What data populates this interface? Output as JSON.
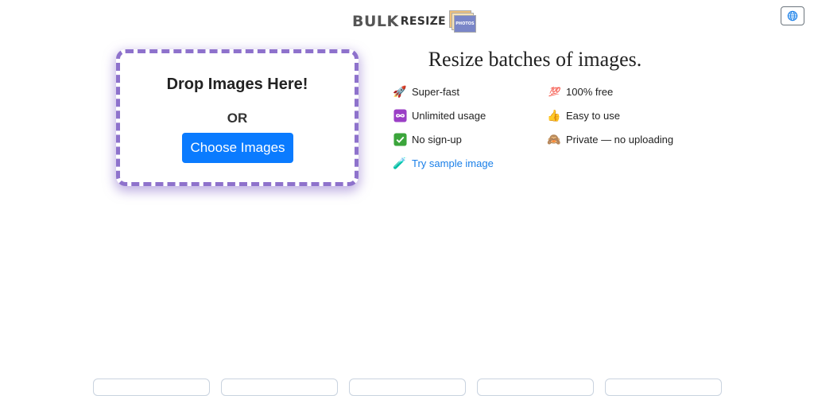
{
  "logo": {
    "bulk": "BULK",
    "resize": "RESIZE",
    "photos": "PHOTOS"
  },
  "dropzone": {
    "title": "Drop Images Here!",
    "or": "OR",
    "button": "Choose Images"
  },
  "headline": "Resize batches of images.",
  "features_left": [
    {
      "label": "Super-fast",
      "icon": "rocket-icon"
    },
    {
      "label": "Unlimited usage",
      "icon": "infinity-icon"
    },
    {
      "label": "No sign-up",
      "icon": "check-icon"
    }
  ],
  "features_right": [
    {
      "label": "100% free",
      "icon": "hundred-icon"
    },
    {
      "label": "Easy to use",
      "icon": "thumbs-up-icon"
    },
    {
      "label": "Private — no uploading",
      "icon": "see-no-evil-monkey-icon"
    }
  ],
  "sample_link": {
    "label": "Try sample image",
    "icon": "test-tube-icon"
  },
  "colors": {
    "accent": "#0a7bff",
    "dropzone_border": "#8e72cc",
    "link": "#1a7fe8"
  }
}
